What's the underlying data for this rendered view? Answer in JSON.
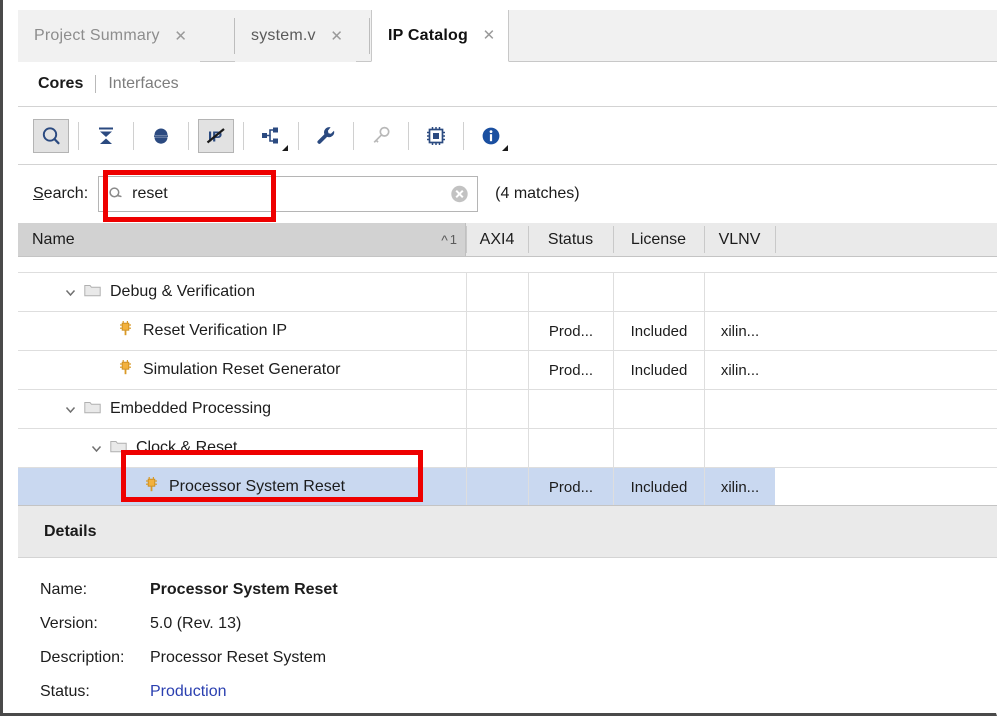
{
  "window": {
    "tabs": [
      {
        "label": "Project Summary",
        "close_icon": "close-icon",
        "active": false
      },
      {
        "label": "system.v",
        "close_icon": "close-icon",
        "active": false
      },
      {
        "label": "IP Catalog",
        "close_icon": "close-icon",
        "active": true
      }
    ]
  },
  "subtabs": {
    "cores": "Cores",
    "interfaces": "Interfaces"
  },
  "toolbar": {
    "buttons": [
      {
        "name": "search-toggle-icon",
        "pressed": true,
        "caret": false
      },
      {
        "name": "collapse-all-icon",
        "pressed": false,
        "caret": false
      },
      {
        "name": "expand-all-icon",
        "pressed": false,
        "caret": false
      },
      {
        "name": "hide-obsolete-icon",
        "pressed": true,
        "caret": false
      },
      {
        "name": "ip-hierarchy-icon",
        "pressed": false,
        "caret": true
      },
      {
        "name": "settings-wrench-icon",
        "pressed": false,
        "caret": false
      },
      {
        "name": "license-key-icon",
        "pressed": false,
        "caret": false
      },
      {
        "name": "device-chip-icon",
        "pressed": false,
        "caret": false
      },
      {
        "name": "information-icon",
        "pressed": false,
        "caret": true
      }
    ]
  },
  "search": {
    "label_prefix": "S",
    "label_rest": "earch:",
    "icon": "magnifier-icon",
    "value": "reset",
    "placeholder": "Search",
    "clear_icon": "clear-circle-icon",
    "match_count": "(4 matches)"
  },
  "table": {
    "columns": [
      {
        "key": "name",
        "label": "Name"
      },
      {
        "key": "axi4",
        "label": "AXI4"
      },
      {
        "key": "status",
        "label": "Status"
      },
      {
        "key": "license",
        "label": "License"
      },
      {
        "key": "vlnv",
        "label": "VLNV"
      }
    ],
    "sort": {
      "direction_icon": "caret-up-icon",
      "order": "1"
    },
    "rows": [
      {
        "kind": "partial",
        "indent": 2,
        "name": "",
        "axi4": "",
        "status": "",
        "license": "",
        "vlnv": "",
        "selected": false
      },
      {
        "kind": "folder",
        "indent": 1,
        "expand_icon": "chevron-down-icon",
        "type_icon": "folder-icon",
        "name": "Debug & Verification",
        "axi4": "",
        "status": "",
        "license": "",
        "vlnv": "",
        "selected": false
      },
      {
        "kind": "ip",
        "indent": 3,
        "type_icon": "ip-core-icon",
        "name": "Reset Verification IP",
        "axi4": "",
        "status": "Prod...",
        "license": "Included",
        "vlnv": "xilin...",
        "selected": false
      },
      {
        "kind": "ip",
        "indent": 3,
        "type_icon": "ip-core-icon",
        "name": "Simulation Reset Generator",
        "axi4": "",
        "status": "Prod...",
        "license": "Included",
        "vlnv": "xilin...",
        "selected": false
      },
      {
        "kind": "folder",
        "indent": 1,
        "expand_icon": "chevron-down-icon",
        "type_icon": "folder-icon",
        "name": "Embedded Processing",
        "axi4": "",
        "status": "",
        "license": "",
        "vlnv": "",
        "selected": false
      },
      {
        "kind": "folder",
        "indent": 2,
        "expand_icon": "chevron-down-icon",
        "type_icon": "folder-icon",
        "name": "Clock & Reset",
        "axi4": "",
        "status": "",
        "license": "",
        "vlnv": "",
        "selected": false
      },
      {
        "kind": "ip",
        "indent": 4,
        "type_icon": "ip-core-icon",
        "name": "Processor System Reset",
        "axi4": "",
        "status": "Prod...",
        "license": "Included",
        "vlnv": "xilin...",
        "selected": true
      }
    ]
  },
  "details": {
    "title": "Details",
    "fields": [
      {
        "key": "Name:",
        "value": "Processor System Reset",
        "style": "bold"
      },
      {
        "key": "Version:",
        "value": "5.0 (Rev. 13)",
        "style": "plain"
      },
      {
        "key": "Description:",
        "value": "Processor Reset System",
        "style": "plain"
      },
      {
        "key": "Status:",
        "value": "Production",
        "style": "link"
      }
    ]
  },
  "annotations": [
    {
      "name": "search-field-highlight",
      "color": "#ee0000"
    },
    {
      "name": "selected-ip-highlight",
      "color": "#ee0000"
    }
  ],
  "colors": {
    "selection_blue": "#c9d8f0",
    "annotation_red": "#ee0000",
    "icon_blue": "#2b4a80",
    "ip_icon_orange": "#f0a830",
    "link_blue": "#2a3fb0"
  }
}
